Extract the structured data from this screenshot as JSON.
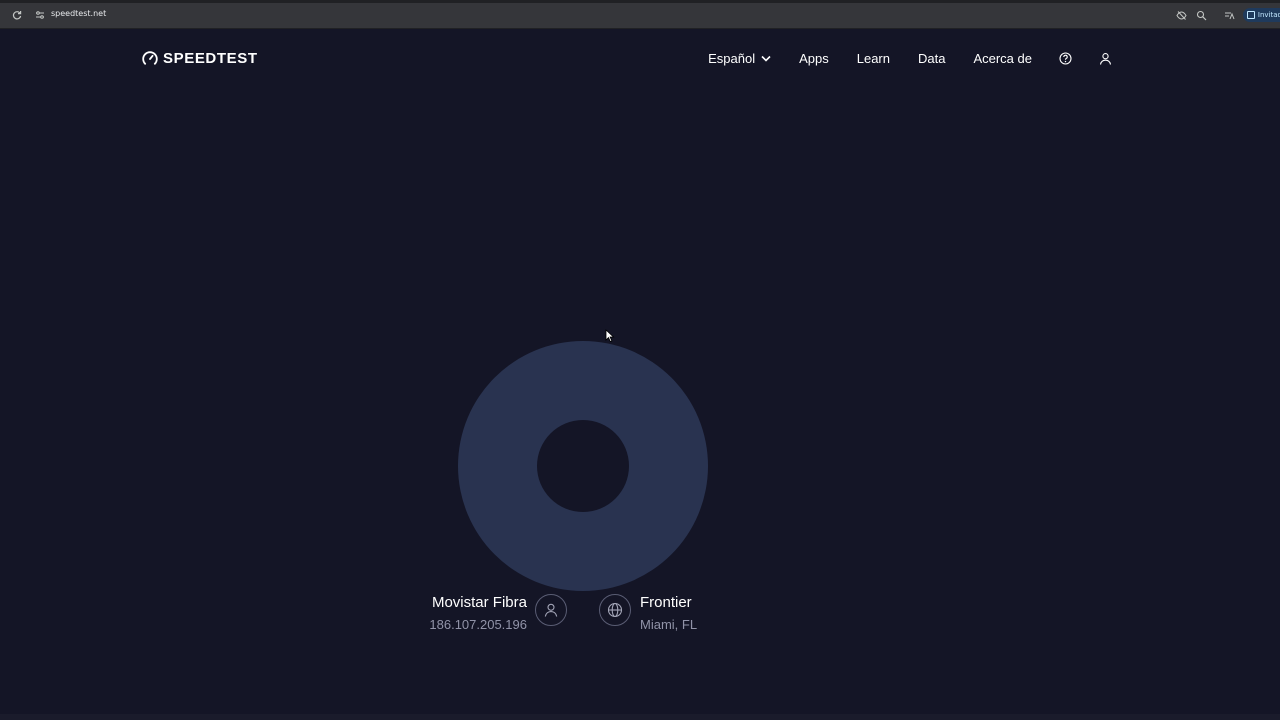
{
  "browser": {
    "url": "speedtest.net",
    "profile_label": "Invitad"
  },
  "header": {
    "logo_text": "SPEEDTEST",
    "nav": {
      "language": "Español",
      "apps": "Apps",
      "learn": "Learn",
      "data": "Data",
      "about": "Acerca de"
    }
  },
  "connection": {
    "isp_name": "Movistar Fibra",
    "isp_ip": "186.107.205.196",
    "server_name": "Frontier",
    "server_location": "Miami, FL"
  },
  "colors": {
    "background": "#141526",
    "gauge": "#293350",
    "muted_text": "#9193a8"
  }
}
